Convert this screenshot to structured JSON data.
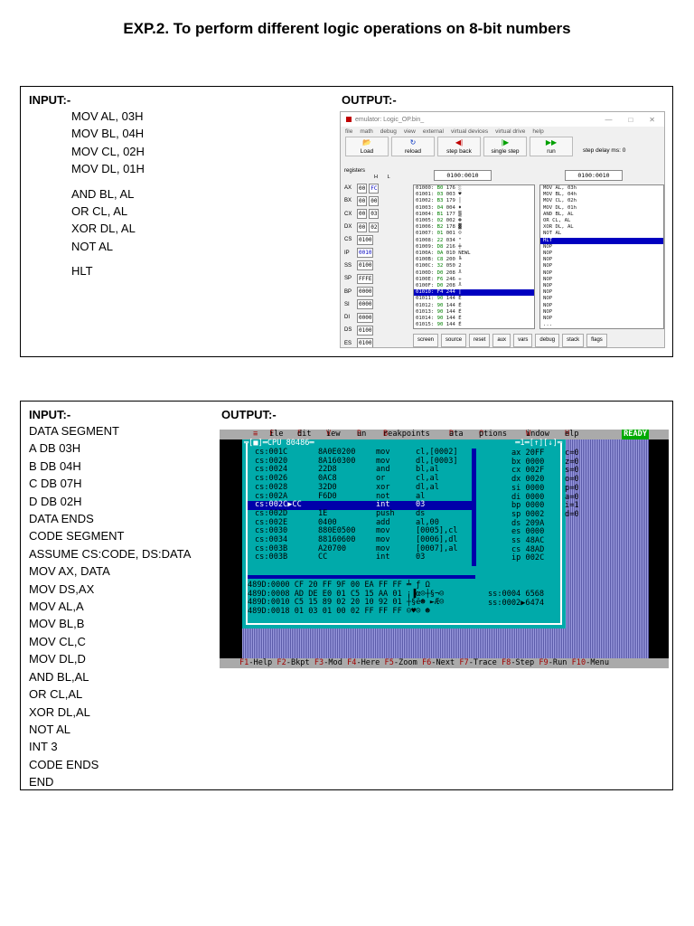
{
  "title": "EXP.2. To perform different logic operations on 8-bit numbers",
  "section1": {
    "input_label": "INPUT:-",
    "output_label": "OUTPUT:-",
    "code_group1": [
      "MOV AL, 03H",
      "MOV BL, 04H",
      "MOV CL, 02H",
      "MOV DL, 01H"
    ],
    "code_group2": [
      "AND BL, AL",
      "OR CL, AL",
      "XOR DL, AL",
      "NOT AL"
    ],
    "code_group3": [
      "HLT"
    ]
  },
  "emulator": {
    "window_title": "emulator: Logic_OP.bin_",
    "menu": [
      "file",
      "math",
      "debug",
      "view",
      "external",
      "virtual devices",
      "virtual drive",
      "help"
    ],
    "toolbar": [
      {
        "icon": "📂",
        "label": "Load"
      },
      {
        "icon": "↻",
        "label": "reload"
      },
      {
        "icon": "◀|",
        "label": "step back"
      },
      {
        "icon": "|▶",
        "label": "single step"
      },
      {
        "icon": "▶▶",
        "label": "run"
      }
    ],
    "step_delay": "step delay ms: 0",
    "registers_label": "registers",
    "hl_label": "H       L",
    "registers": [
      {
        "name": "AX",
        "h": "00",
        "l": "FC"
      },
      {
        "name": "BX",
        "h": "00",
        "l": "00"
      },
      {
        "name": "CX",
        "h": "00",
        "l": "03"
      },
      {
        "name": "DX",
        "h": "00",
        "l": "02"
      },
      {
        "name": "CS",
        "v": "0100"
      },
      {
        "name": "IP",
        "v": "0010"
      },
      {
        "name": "SS",
        "v": "0100"
      },
      {
        "name": "SP",
        "v": "FFFE"
      },
      {
        "name": "BP",
        "v": "0000"
      },
      {
        "name": "SI",
        "v": "0000"
      },
      {
        "name": "DI",
        "v": "0000"
      },
      {
        "name": "DS",
        "v": "0100"
      },
      {
        "name": "ES",
        "v": "0100"
      }
    ],
    "mem_address": "0100:0010",
    "dis_address": "0100:0010",
    "memory": [
      {
        "addr": "01000:",
        "byte": "B0",
        "dec": "176",
        "ch": "░"
      },
      {
        "addr": "01001:",
        "byte": "03",
        "dec": "003",
        "ch": "♥"
      },
      {
        "addr": "01002:",
        "byte": "B3",
        "dec": "179",
        "ch": "│"
      },
      {
        "addr": "01003:",
        "byte": "04",
        "dec": "004",
        "ch": "♦"
      },
      {
        "addr": "01004:",
        "byte": "B1",
        "dec": "177",
        "ch": "▒"
      },
      {
        "addr": "01005:",
        "byte": "02",
        "dec": "002",
        "ch": "☻"
      },
      {
        "addr": "01006:",
        "byte": "B2",
        "dec": "178",
        "ch": "▓"
      },
      {
        "addr": "01007:",
        "byte": "01",
        "dec": "001",
        "ch": "☺"
      },
      {
        "addr": "01008:",
        "byte": "22",
        "dec": "034",
        "ch": "\""
      },
      {
        "addr": "01009:",
        "byte": "D8",
        "dec": "216",
        "ch": "╪"
      },
      {
        "addr": "0100A:",
        "byte": "0A",
        "dec": "010",
        "ch": "NEWL"
      },
      {
        "addr": "0100B:",
        "byte": "C8",
        "dec": "200",
        "ch": "╚"
      },
      {
        "addr": "0100C:",
        "byte": "32",
        "dec": "050",
        "ch": "2"
      },
      {
        "addr": "0100D:",
        "byte": "D0",
        "dec": "208",
        "ch": "╨"
      },
      {
        "addr": "0100E:",
        "byte": "F6",
        "dec": "246",
        "ch": "÷"
      },
      {
        "addr": "0100F:",
        "byte": "D0",
        "dec": "208",
        "ch": "╨"
      },
      {
        "addr": "01010:",
        "byte": "F4",
        "dec": "244",
        "ch": "⌠"
      },
      {
        "addr": "01011:",
        "byte": "90",
        "dec": "144",
        "ch": "É"
      },
      {
        "addr": "01012:",
        "byte": "90",
        "dec": "144",
        "ch": "É"
      },
      {
        "addr": "01013:",
        "byte": "90",
        "dec": "144",
        "ch": "É"
      },
      {
        "addr": "01014:",
        "byte": "90",
        "dec": "144",
        "ch": "É"
      },
      {
        "addr": "01015:",
        "byte": "90",
        "dec": "144",
        "ch": "É"
      }
    ],
    "memory_selected_index": 16,
    "disassembly": [
      "MOV AL, 03h",
      "MOV BL, 04h",
      "MOV CL, 02h",
      "MOV DL, 01h",
      "AND BL, AL",
      "OR CL, AL",
      "XOR DL, AL",
      "NOT AL",
      "HLT",
      "NOP",
      "NOP",
      "NOP",
      "NOP",
      "NOP",
      "NOP",
      "NOP",
      "NOP",
      "NOP",
      "NOP",
      "NOP",
      "NOP",
      "..."
    ],
    "disassembly_selected_index": 8,
    "bottom_buttons": [
      "screen",
      "source",
      "reset",
      "aux",
      "vars",
      "debug",
      "stack",
      "flags"
    ]
  },
  "section2": {
    "input_label": "INPUT:-",
    "output_label": "OUTPUT:-",
    "code": [
      "DATA SEGMENT",
      "A DB 03H",
      "B DB 04H",
      "C DB 07H",
      "D DB 02H",
      "DATA ENDS",
      "CODE SEGMENT",
      "ASSUME CS:CODE, DS:DATA",
      "MOV AX, DATA",
      "MOV DS,AX",
      "MOV AL,A",
      "MOV BL,B",
      "MOV CL,C",
      "MOV DL,D",
      "AND BL,AL",
      "OR CL,AL",
      "XOR DL,AL",
      "NOT AL",
      "INT 3",
      "CODE ENDS",
      "END"
    ]
  },
  "debugger": {
    "menu": [
      {
        "hot": "≡",
        "rest": ""
      },
      {
        "hot": "F",
        "rest": "ile"
      },
      {
        "hot": "E",
        "rest": "dit"
      },
      {
        "hot": "V",
        "rest": "iew"
      },
      {
        "hot": "R",
        "rest": "un"
      },
      {
        "hot": "B",
        "rest": "reakpoints"
      },
      {
        "hot": "D",
        "rest": "ata"
      },
      {
        "hot": "O",
        "rest": "ptions"
      },
      {
        "hot": "W",
        "rest": "indow"
      },
      {
        "hot": "H",
        "rest": "elp"
      }
    ],
    "status": "READY",
    "cpu_title": "═[■]═CPU 80486═",
    "cpu_right_title": "═1═[↑][↓]═",
    "code_lines": [
      {
        "addr": "cs:001C",
        "bytes": "8A0E0200",
        "mn": "mov",
        "op": "cl,[0002]"
      },
      {
        "addr": "cs:0020",
        "bytes": "8A160300",
        "mn": "mov",
        "op": "dl,[0003]"
      },
      {
        "addr": "cs:0024",
        "bytes": "22D8",
        "mn": "and",
        "op": "bl,al"
      },
      {
        "addr": "cs:0026",
        "bytes": "0AC8",
        "mn": "or",
        "op": "cl,al"
      },
      {
        "addr": "cs:0028",
        "bytes": "32D0",
        "mn": "xor",
        "op": "dl,al"
      },
      {
        "addr": "cs:002A",
        "bytes": "F6D0",
        "mn": "not",
        "op": "al"
      },
      {
        "addr": "cs:002C▶CC",
        "bytes": "",
        "mn": "int",
        "op": "03"
      },
      {
        "addr": "cs:002D",
        "bytes": "1E",
        "mn": "push",
        "op": "ds"
      },
      {
        "addr": "cs:002E",
        "bytes": "0400",
        "mn": "add",
        "op": "al,00"
      },
      {
        "addr": "cs:0030",
        "bytes": "880E0500",
        "mn": "mov",
        "op": "[0005],cl"
      },
      {
        "addr": "cs:0034",
        "bytes": "88160600",
        "mn": "mov",
        "op": "[0006],dl"
      },
      {
        "addr": "cs:003B",
        "bytes": "A20700",
        "mn": "mov",
        "op": "[0007],al"
      },
      {
        "addr": "cs:003B",
        "bytes": "CC",
        "mn": "int",
        "op": "03"
      }
    ],
    "code_selected_index": 6,
    "registers": [
      {
        "name": "ax",
        "v": "20FF"
      },
      {
        "name": "bx",
        "v": "0000"
      },
      {
        "name": "cx",
        "v": "002F"
      },
      {
        "name": "dx",
        "v": "0020"
      },
      {
        "name": "si",
        "v": "0000"
      },
      {
        "name": "di",
        "v": "0000"
      },
      {
        "name": "bp",
        "v": "0000"
      },
      {
        "name": "sp",
        "v": "0002"
      },
      {
        "name": "ds",
        "v": "209A"
      },
      {
        "name": "es",
        "v": "0000"
      },
      {
        "name": "ss",
        "v": "48AC"
      },
      {
        "name": "cs",
        "v": "48AD"
      },
      {
        "name": "ip",
        "v": "002C"
      }
    ],
    "flags": [
      {
        "name": "c",
        "v": "0"
      },
      {
        "name": "z",
        "v": "0"
      },
      {
        "name": "s",
        "v": "0"
      },
      {
        "name": "o",
        "v": "0"
      },
      {
        "name": "p",
        "v": "0"
      },
      {
        "name": "a",
        "v": "0"
      },
      {
        "name": "i",
        "v": "1"
      },
      {
        "name": "d",
        "v": "0"
      }
    ],
    "dump_lines": [
      "489D:0000 CF 20 FF 9F 00 EA FF FF ╧ ƒ Ω",
      "489D:0008 AD DE E0 01 C5 15 AA 01 ¡▐α☺┼§¬☺",
      "489D:0010 C5 15 89 02 20 10 92 01 ┼§ë☻ ►Æ☺",
      "489D:0018 01 03 01 00 02 FF FF FF ☺♥☺ ☻"
    ],
    "stack_lines": [
      "ss:0004 6568",
      "ss:0002▶6474"
    ],
    "fkeys": [
      {
        "k": "F1",
        "t": "-Help"
      },
      {
        "k": "F2",
        "t": "-Bkpt"
      },
      {
        "k": "F3",
        "t": "-Mod"
      },
      {
        "k": "F4",
        "t": "-Here"
      },
      {
        "k": "F5",
        "t": "-Zoom"
      },
      {
        "k": "F6",
        "t": "-Next"
      },
      {
        "k": "F7",
        "t": "-Trace"
      },
      {
        "k": "F8",
        "t": "-Step"
      },
      {
        "k": "F9",
        "t": "-Run"
      },
      {
        "k": "F10",
        "t": "-Menu"
      }
    ]
  }
}
